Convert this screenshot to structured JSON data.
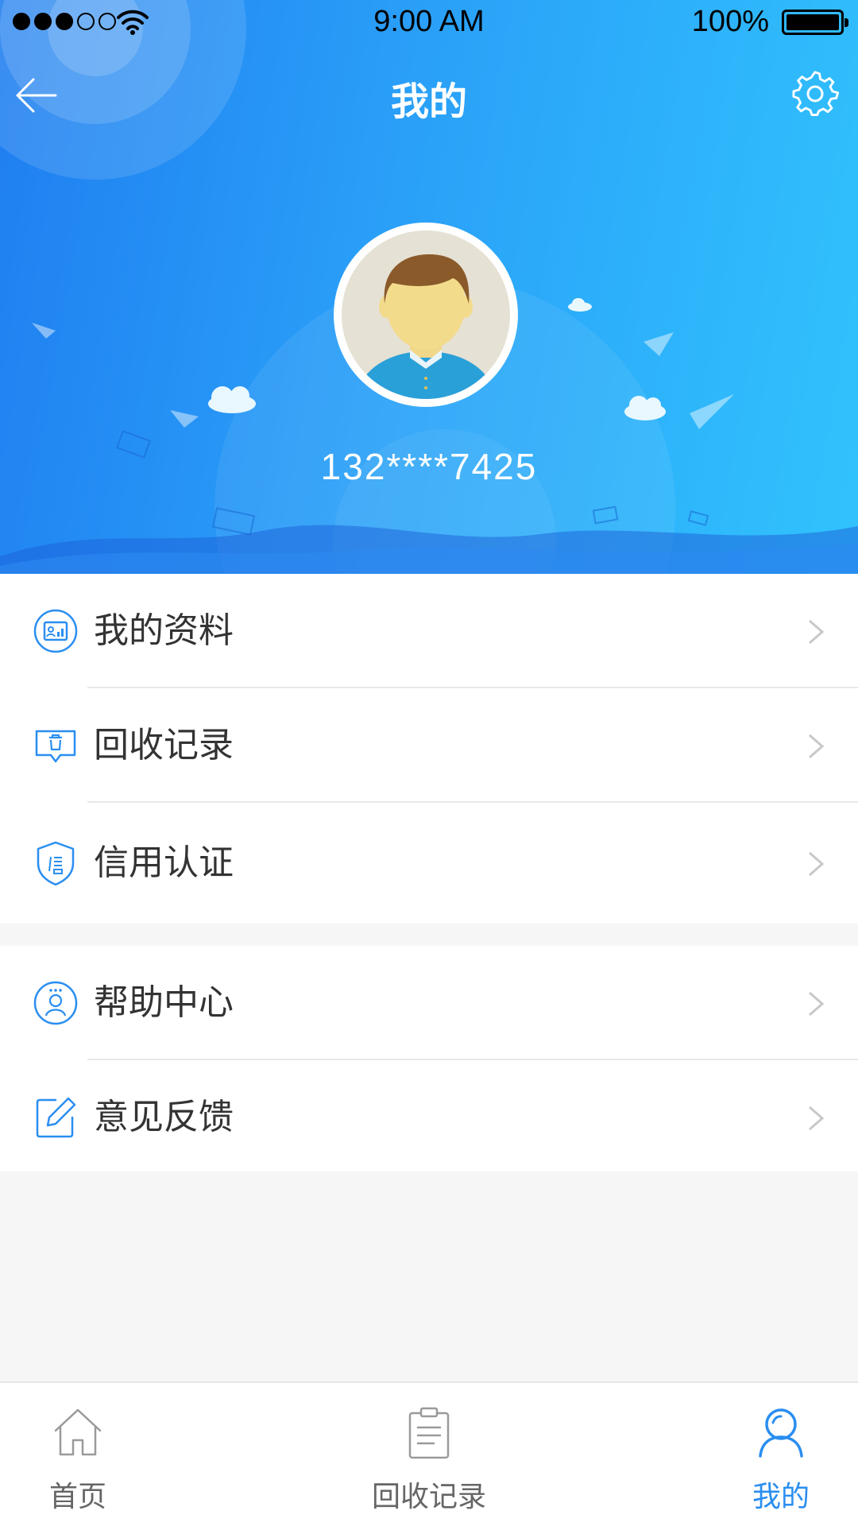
{
  "status_bar": {
    "time": "9:00 AM",
    "battery": "100%",
    "signal_level": 3,
    "signal_total": 5
  },
  "nav": {
    "title": "我的",
    "back_icon": "back-arrow-icon",
    "settings_icon": "gear-icon"
  },
  "profile": {
    "phone": "132****7425",
    "avatar_icon": "default-male-avatar"
  },
  "menu_group_1": [
    {
      "label": "我的资料",
      "icon": "profile-card-icon"
    },
    {
      "label": "回收记录",
      "icon": "recycle-bin-icon"
    },
    {
      "label": "信用认证",
      "icon": "credit-shield-icon"
    }
  ],
  "menu_group_2": [
    {
      "label": "帮助中心",
      "icon": "help-person-icon"
    },
    {
      "label": "意见反馈",
      "icon": "feedback-edit-icon"
    }
  ],
  "tabbar": {
    "items": [
      {
        "label": "首页",
        "icon": "home-icon",
        "active": false
      },
      {
        "label": "回收记录",
        "icon": "clipboard-icon",
        "active": false
      },
      {
        "label": "我的",
        "icon": "user-icon",
        "active": true
      }
    ]
  },
  "colors": {
    "accent": "#2a8ef0",
    "header_start": "#1f7ef0",
    "header_end": "#31c3fd",
    "text": "#333333",
    "tab_inactive": "#666666"
  }
}
